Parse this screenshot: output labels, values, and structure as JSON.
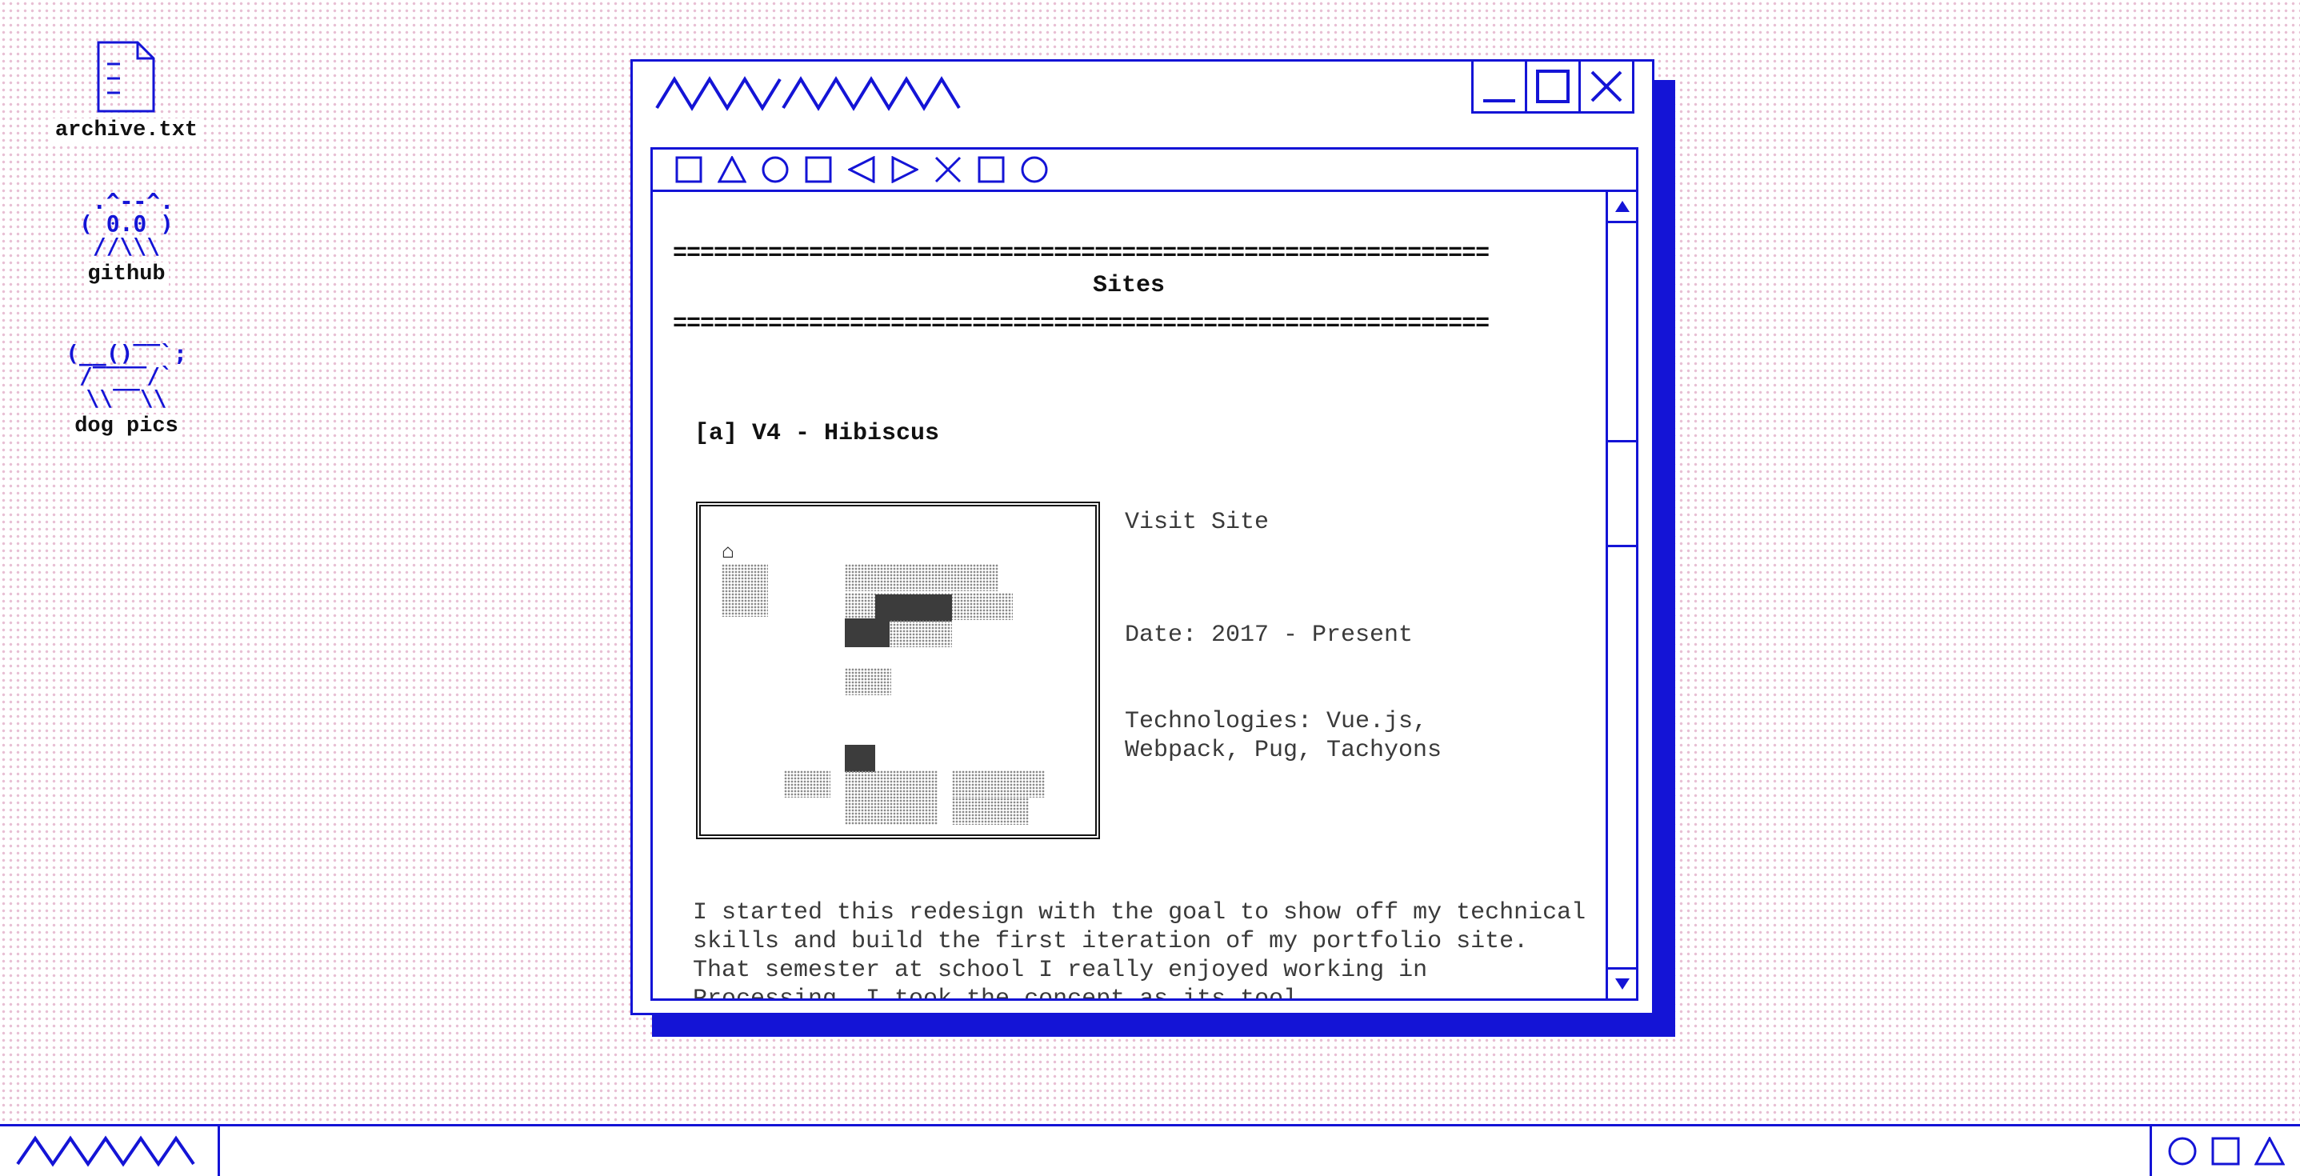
{
  "desktop": {
    "icons": [
      {
        "label": "archive.txt",
        "icon": "document-icon"
      },
      {
        "label": "github",
        "icon": "octocat-ascii-icon",
        "art": " .^--^.\n( 0.0 )\n //\\\\\\ "
      },
      {
        "label": "dog pics",
        "icon": "dog-ascii-icon",
        "art": "(__()‾‾`;\n /‾‾‾‾/` \n \\\\‾‾\\\\ "
      }
    ]
  },
  "window": {
    "title_icon": "zigzag-title-icon",
    "controls": [
      "minimize-icon",
      "maximize-icon",
      "close-icon"
    ],
    "toolbar_icons": [
      "square-icon",
      "triangle-icon",
      "circle-icon",
      "square-icon",
      "triangle-left-icon",
      "triangle-right-icon",
      "x-icon",
      "square-icon",
      "circle-icon"
    ],
    "content": {
      "rule": "============================================================",
      "heading": "Sites",
      "entry": {
        "title": "[a] V4 - Hibiscus",
        "visit_label": "Visit Site",
        "date": "Date: 2017 - Present",
        "technologies": "Technologies: Vue.js,\nWebpack, Pug, Tachyons",
        "description": "I started this redesign with the goal to show off my technical skills and build the first iteration of my portfolio site. That semester at school I really enjoyed working in Processing. I took the concept as its tool"
      }
    }
  },
  "taskbar": {
    "start_icon": "zigzag-start-icon",
    "tray_icons": [
      "circle-icon",
      "square-icon",
      "triangle-icon"
    ]
  },
  "colors": {
    "accent": "#1414d6",
    "background_dots": "#e8bfd4"
  }
}
